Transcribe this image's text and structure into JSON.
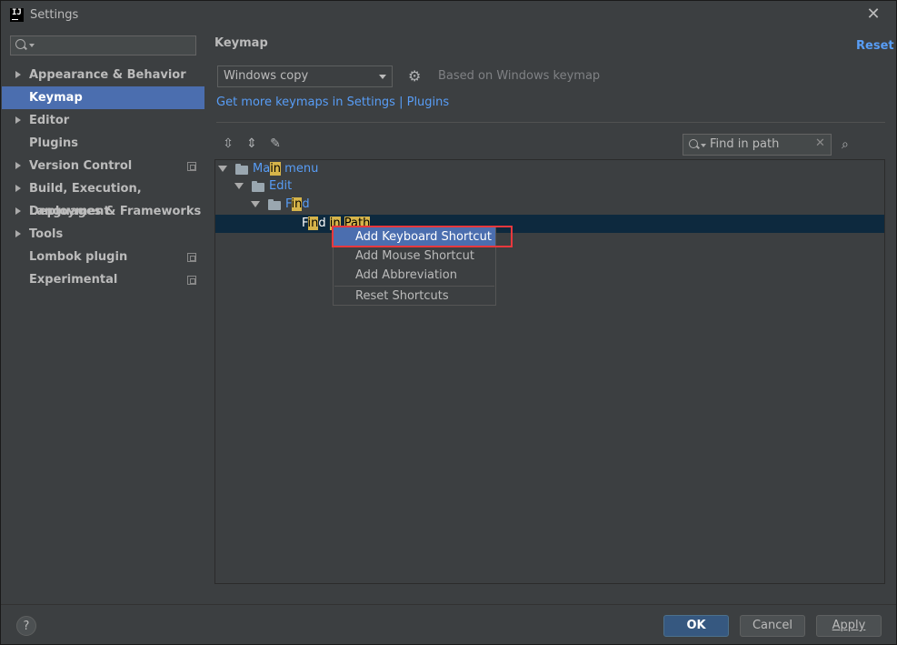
{
  "window": {
    "title": "Settings",
    "app_icon_text": "IJ",
    "close_glyph": "✕"
  },
  "sidebar": {
    "search_placeholder": "",
    "items": [
      {
        "label": "Appearance & Behavior",
        "expandable": true,
        "selected": false,
        "project_icon": false
      },
      {
        "label": "Keymap",
        "expandable": false,
        "selected": true,
        "project_icon": false
      },
      {
        "label": "Editor",
        "expandable": true,
        "selected": false,
        "project_icon": false
      },
      {
        "label": "Plugins",
        "expandable": false,
        "selected": false,
        "project_icon": false
      },
      {
        "label": "Version Control",
        "expandable": true,
        "selected": false,
        "project_icon": true
      },
      {
        "label": "Build, Execution, Deployment",
        "expandable": true,
        "selected": false,
        "project_icon": false
      },
      {
        "label": "Languages & Frameworks",
        "expandable": true,
        "selected": false,
        "project_icon": false
      },
      {
        "label": "Tools",
        "expandable": true,
        "selected": false,
        "project_icon": false
      },
      {
        "label": "Lombok plugin",
        "expandable": false,
        "selected": false,
        "project_icon": true
      },
      {
        "label": "Experimental",
        "expandable": false,
        "selected": false,
        "project_icon": true
      }
    ]
  },
  "main": {
    "title": "Keymap",
    "reset_label": "Reset",
    "keymap_value": "Windows copy",
    "based_on": "Based on Windows keymap",
    "more_keymaps": "Get more keymaps in Settings | Plugins",
    "search_value": "Find in path",
    "tree": {
      "main_menu": {
        "before": "Ma",
        "match": "in",
        "after": " menu"
      },
      "edit": "Edit",
      "find": {
        "before": "F",
        "match": "in",
        "after": "d"
      },
      "find_in_path": {
        "p1": "F",
        "m1": "in",
        "p2": "d ",
        "m2": "in",
        "p3": " ",
        "m3": "Path"
      }
    },
    "context_menu": [
      "Add Keyboard Shortcut",
      "Add Mouse Shortcut",
      "Add Abbreviation",
      "Reset Shortcuts"
    ]
  },
  "footer": {
    "help": "?",
    "ok": "OK",
    "cancel": "Cancel",
    "apply": "Apply"
  },
  "colors": {
    "background": "#3c3f41",
    "selection": "#4b6eaf",
    "link": "#589df6",
    "highlight_match": "#d6b44a",
    "red_outline": "#e8383d"
  },
  "icons": [
    "search-icon",
    "settings-gear-icon",
    "expand-all-icon",
    "collapse-all-icon",
    "edit-pencil-icon",
    "find-shortcut-icon",
    "folder-icon",
    "menu-folder-icon",
    "help-icon",
    "close-icon",
    "project-level-icon"
  ]
}
